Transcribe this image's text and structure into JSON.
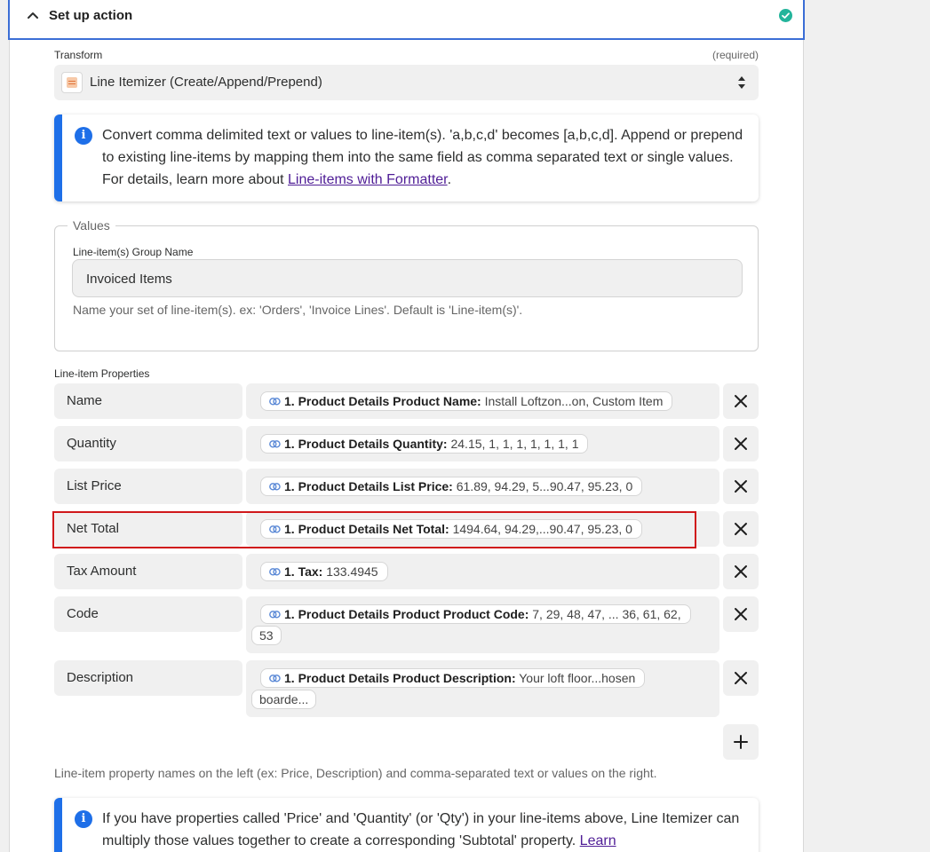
{
  "header": {
    "title": "Set up action"
  },
  "transform": {
    "label": "Transform",
    "required": "(required)",
    "value": "Line Itemizer (Create/Append/Prepend)"
  },
  "info1": {
    "text": "Convert comma delimited text or values to line-item(s). 'a,b,c,d' becomes [a,b,c,d]. Append or prepend to existing line-items by mapping them into the same field as comma separated text or single values. For details, learn more about ",
    "link": "Line-items with Formatter",
    "end": "."
  },
  "values": {
    "legend": "Values",
    "group_label": "Line-item(s) Group Name",
    "group_value": "Invoiced Items",
    "group_help": "Name your set of line-item(s). ex: 'Orders', 'Invoice Lines'. Default is 'Line-item(s)'."
  },
  "properties": {
    "label": "Line-item Properties",
    "rows": [
      {
        "key": "Name",
        "pills": [
          {
            "k": "1. Product Details Product Name:",
            "v": "Install Loftzon...on, Custom Item"
          }
        ]
      },
      {
        "key": "Quantity",
        "pills": [
          {
            "k": "1. Product Details Quantity:",
            "v": "24.15, 1, 1, 1, 1, 1, 1, 1"
          }
        ]
      },
      {
        "key": "List Price",
        "pills": [
          {
            "k": "1. Product Details List Price:",
            "v": "61.89, 94.29, 5...90.47, 95.23, 0"
          }
        ]
      },
      {
        "key": "Net Total",
        "pills": [
          {
            "k": "1. Product Details Net Total:",
            "v": "1494.64, 94.29,...90.47, 95.23, 0"
          }
        ]
      },
      {
        "key": "Tax Amount",
        "pills": [
          {
            "k": "1. Tax:",
            "v": "133.4945"
          }
        ]
      },
      {
        "key": "Code",
        "pills": [
          {
            "k": "1. Product Details Product Product Code:",
            "v": "7, 29, 48, 47, ... 36, 61, 62,"
          },
          {
            "k": "",
            "v": "53"
          }
        ]
      },
      {
        "key": "Description",
        "pills": [
          {
            "k": "1. Product Details Product Description:",
            "v": "Your loft floor...hosen"
          },
          {
            "k": "",
            "v": "boarde..."
          }
        ]
      }
    ],
    "footnote": "Line-item property names on the left (ex: Price, Description) and comma-separated text or values on the right."
  },
  "info2": {
    "text": "If you have properties called 'Price' and 'Quantity' (or 'Qty') in your line-items above, Line Itemizer can multiply those values together to create a corresponding 'Subtotal' property. ",
    "link": "Learn"
  },
  "colors": {
    "accent": "#1e6fe8",
    "highlight": "#d0181b",
    "success": "#23b49b"
  }
}
